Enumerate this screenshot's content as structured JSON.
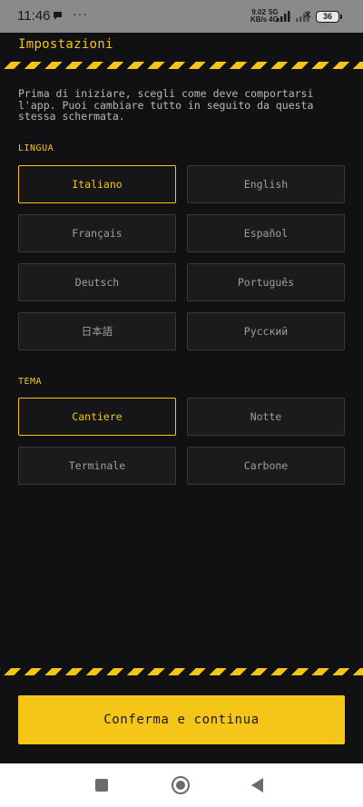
{
  "status_bar": {
    "time": "11:46",
    "overflow": "···",
    "speed_value": "9.02",
    "speed_unit": "KB/s",
    "network_top": "5G",
    "network_bottom": "4G",
    "battery": "36"
  },
  "header": {
    "title": "Impostazioni"
  },
  "intro": {
    "line1": "Prima di iniziare, scegli come deve comportarsi",
    "line2": "l'app. Puoi cambiare tutto in seguito da questa",
    "line3": "stessa schermata."
  },
  "language": {
    "label": "LINGUA",
    "selected": "Italiano",
    "options": [
      "Italiano",
      "English",
      "Français",
      "Español",
      "Deutsch",
      "Português",
      "日本語",
      "Русский"
    ]
  },
  "theme": {
    "label": "TEMA",
    "selected": "Cantiere",
    "options": [
      "Cantiere",
      "Notte",
      "Terminale",
      "Carbone"
    ]
  },
  "confirm": {
    "label": "Conferma e continua"
  },
  "colors": {
    "accent": "#f5c518",
    "background": "#111113",
    "option_bg": "#1b1b1e",
    "option_border": "#38383c"
  }
}
